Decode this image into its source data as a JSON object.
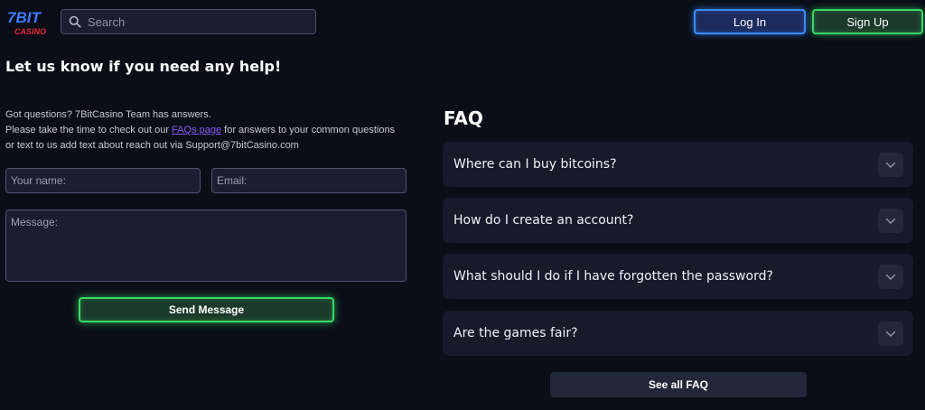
{
  "header": {
    "logo": {
      "text_top": "7BIT",
      "text_bottom": "CASINO",
      "icon": "7bit-casino-logo"
    },
    "search": {
      "placeholder": "Search",
      "icon": "search-icon"
    },
    "login_label": "Log In",
    "signup_label": "Sign Up"
  },
  "contact": {
    "title": "Let us know if you need any help!",
    "intro_line1": "Got questions? 7BitCasino Team has answers.",
    "intro_line2_before": "Please take the time to check out our ",
    "intro_link": "FAQs page",
    "intro_line2_after": " for answers to your common questions or text to us add text about reach out via Support@7bitCasino.com",
    "name_placeholder": "Your name:",
    "email_placeholder": "Email:",
    "message_placeholder": "Message:",
    "send_label": "Send Message"
  },
  "faq": {
    "title": "FAQ",
    "items": [
      {
        "question": "Where can I buy bitcoins?"
      },
      {
        "question": "How do I create an account?"
      },
      {
        "question": "What should I do if I have forgotten the password?"
      },
      {
        "question": "Are the games fair?"
      }
    ],
    "see_all_label": "See all FAQ"
  },
  "colors": {
    "background": "#0b0e17",
    "login_border": "#3a8bff",
    "signup_border": "#39d766",
    "link": "#8a5cf5",
    "logo_blue": "#3d7bff",
    "logo_red": "#e8253c"
  }
}
